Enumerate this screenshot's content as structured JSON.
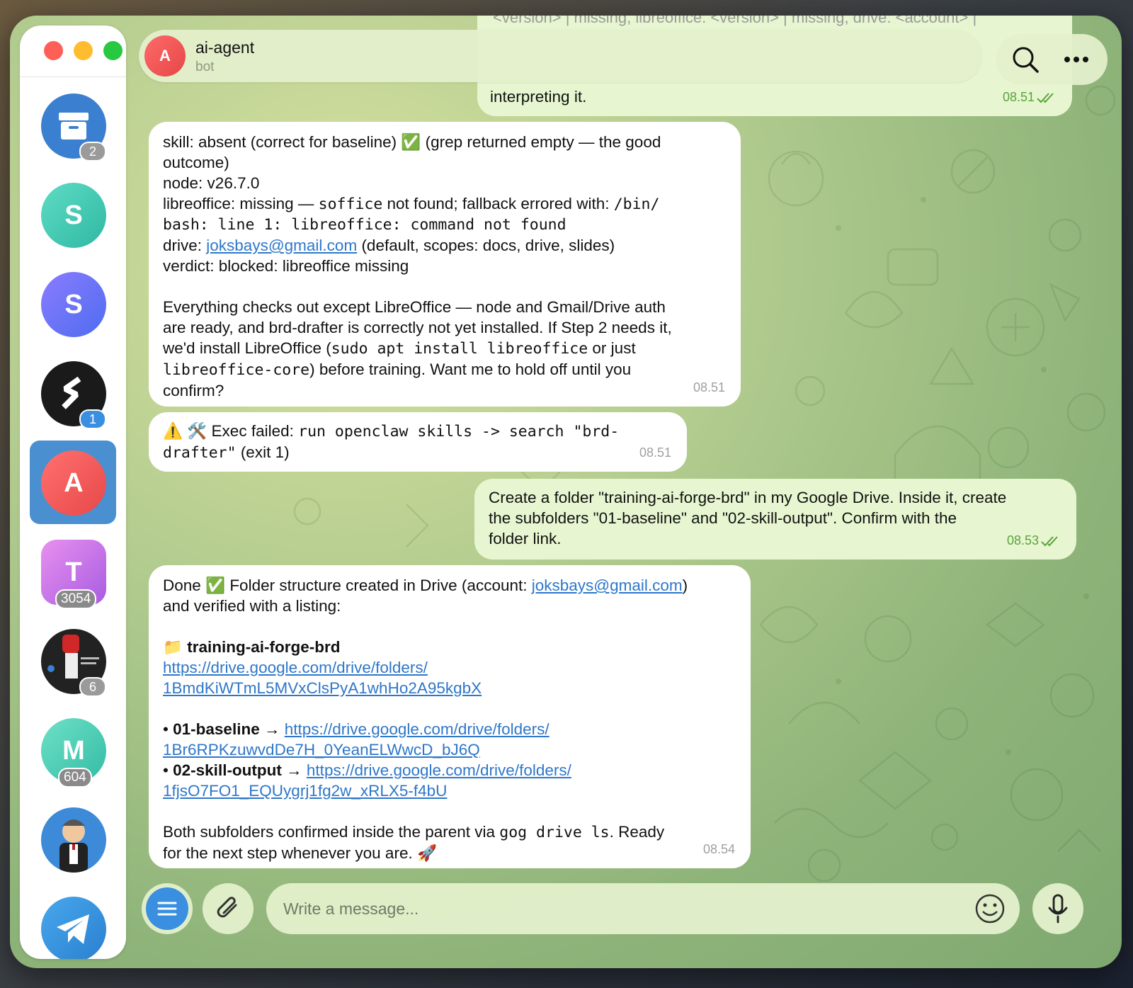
{
  "window": {
    "traffic_lights": {
      "close": "#fe5f57",
      "minimize": "#febc2e",
      "zoom": "#28c840"
    }
  },
  "sidebar": {
    "items": [
      {
        "id": "archive",
        "icon": "archive-box-icon",
        "color": "#3a7fd0",
        "badge": "2"
      },
      {
        "id": "chat-s1",
        "letter": "S",
        "color": "#3cc8b4",
        "badge": ""
      },
      {
        "id": "chat-s2",
        "letter": "S",
        "color": "#6a5cf0",
        "badge": ""
      },
      {
        "id": "chat-stripe",
        "icon": "stripe-logo-icon",
        "color": "#1a1a1a",
        "badge": "1",
        "badge_color": "#3a8fe0"
      },
      {
        "id": "chat-ai-agent",
        "letter": "A",
        "color": "#f25a5a",
        "active": true,
        "badge": ""
      },
      {
        "id": "chat-t",
        "letter": "T",
        "color": "#c06ce0",
        "badge": "3054"
      },
      {
        "id": "chat-group-fist",
        "icon": "fist-poster-icon",
        "color": "#222222",
        "badge": "6"
      },
      {
        "id": "chat-m",
        "letter": "M",
        "color": "#4cc9b0",
        "badge": "604"
      },
      {
        "id": "chat-cartoon",
        "icon": "cartoon-man-icon",
        "color": "#3c8ad8",
        "badge": ""
      },
      {
        "id": "telegram",
        "icon": "telegram-plane-icon",
        "color": "#3a8fe0",
        "badge": ""
      }
    ]
  },
  "header": {
    "avatar_letter": "A",
    "title": "ai-agent",
    "subtitle": "bot",
    "search_icon": "search-icon",
    "more_icon": "more-dots-icon"
  },
  "messages": {
    "m0": {
      "direction": "out",
      "lines": [
        "<version> | missing, libreoffice: <version> | missing, drive: <account> |",
        "... (partially hidden behind header) ...",
        "interpreting it."
      ],
      "visible_last_line": "interpreting it.",
      "time": "08.51"
    },
    "m1": {
      "direction": "in",
      "l1a": "skill: absent (correct for baseline) ",
      "l1emoji": "✅",
      "l1b": " (grep returned empty — the good",
      "l2": "outcome)",
      "l3": "node: v26.7.0",
      "l4a": "libreoffice: missing — ",
      "l4code": "soffice",
      "l4b": " not found; fallback errored with: ",
      "l4code2": "/bin/",
      "l5code": "bash: line 1: libreoffice: command not found",
      "l6a": "drive: ",
      "l6link": "joksbays@gmail.com",
      "l6b": " (default, scopes: docs, drive, slides)",
      "l7": "verdict: blocked: libreoffice missing",
      "p2l1": "Everything checks out except LibreOffice — node and Gmail/Drive auth",
      "p2l2": "are ready, and brd-drafter is correctly not yet installed. If Step 2 needs it,",
      "p2l3a": "we'd install LibreOffice (",
      "p2l3code": "sudo apt install libreoffice",
      "p2l3b": " or just",
      "p2l4code": "libreoffice-core",
      "p2l4b": ") before training. Want me to hold off until you",
      "p2l5": "confirm?",
      "time": "08.51"
    },
    "m2": {
      "direction": "in",
      "emoji": "⚠️ 🛠️",
      "l1a": " Exec failed: ",
      "l1code": "run openclaw skills -> search \"brd-",
      "l2code": "drafter\"",
      "l2b": " (exit 1)",
      "time": "08.51"
    },
    "m3": {
      "direction": "out",
      "l1": "Create a folder \"training-ai-forge-brd\" in my Google Drive. Inside it, create",
      "l2": "the subfolders \"01-baseline\" and \"02-skill-output\". Confirm with the",
      "l3": "folder link.",
      "time": "08.53"
    },
    "m4": {
      "direction": "in",
      "l1a": "Done ",
      "l1emoji": "✅",
      "l1b": " Folder structure created in Drive (account: ",
      "l1link": "joksbays@gmail.com",
      "l1c": ")",
      "l2": "and verified with a listing:",
      "folder_emoji": "📁",
      "folder_name": "training-ai-forge-brd",
      "folder_link_l1": "https://drive.google.com/drive/folders/",
      "folder_link_l2": "1BmdKiWTmL5MVxClsPyA1whHo2A95kgbX",
      "sub1_bullet": "• ",
      "sub1_name": "01-baseline",
      "sub1_arrow": " → ",
      "sub1_link_l1": "https://drive.google.com/drive/folders/",
      "sub1_link_l2": "1Br6RPKzuwvdDe7H_0YeanELWwcD_bJ6Q",
      "sub2_bullet": "• ",
      "sub2_name": "02-skill-output",
      "sub2_arrow": " → ",
      "sub2_link_l1": "https://drive.google.com/drive/folders/",
      "sub2_link_l2": "1fjsO7FO1_EQUygrj1fg2w_xRLX5-f4bU",
      "p3l1a": "Both subfolders confirmed inside the parent via ",
      "p3l1code": "gog drive ls",
      "p3l1b": ". Ready",
      "p3l2a": "for the next step whenever you are. ",
      "p3l2emoji": "🚀",
      "time": "08.54"
    }
  },
  "composer": {
    "placeholder": "Write a message...",
    "menu_icon": "menu-icon",
    "attach_icon": "paperclip-icon",
    "emoji_icon": "emoji-smile-icon",
    "mic_icon": "microphone-icon"
  },
  "colors": {
    "accent": "#3a8fe0",
    "outgoing_bubble": "#e7f6d0",
    "incoming_bubble": "#ffffff",
    "read_check": "#5aa33c"
  }
}
